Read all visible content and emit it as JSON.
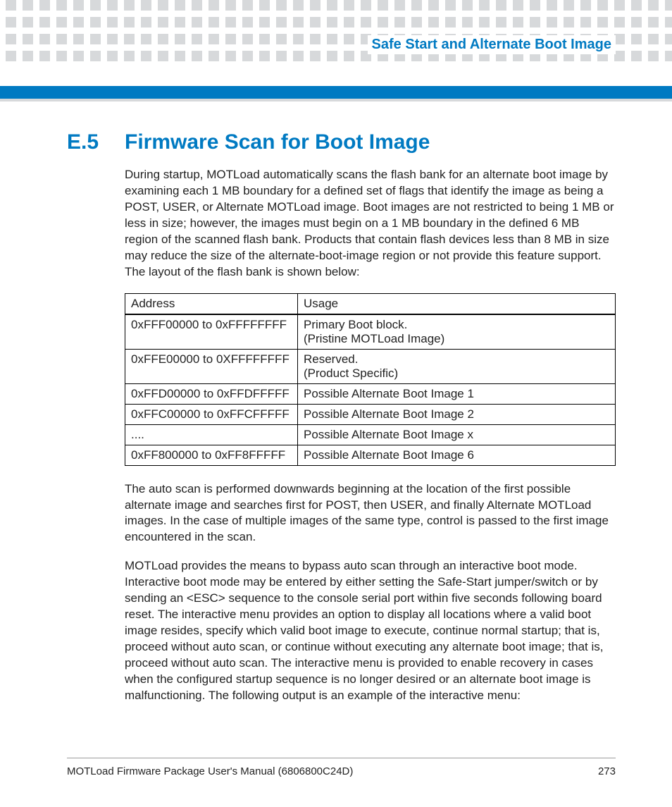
{
  "header": {
    "chapter_title": "Safe Start and Alternate Boot Image"
  },
  "section": {
    "number": "E.5",
    "title": "Firmware Scan for Boot Image"
  },
  "paragraphs": {
    "p1": "During startup, MOTLoad automatically scans the flash bank for an alternate boot image by examining each 1 MB  boundary for a defined set of flags that identify the image as being a POST, USER, or Alternate MOTLoad image. Boot images are not restricted to being 1 MB  or less in size; however, the images must begin on a 1 MB boundary in the defined 6 MB region of the scanned flash bank. Products that contain flash devices less than 8 MB in size may reduce the size of the alternate-boot-image region or not provide this feature support. The layout of the flash bank is shown below:",
    "p2": "The auto scan is performed downwards beginning at the location of the first possible alternate image and searches first for POST, then USER, and finally Alternate MOTLoad images. In the case of multiple images of the same type, control is passed to the first image encountered in the scan.",
    "p3": "MOTLoad provides the means to bypass auto scan through an interactive boot mode. Interactive boot mode may be entered by either setting the Safe-Start jumper/switch or by sending an <ESC> sequence to the console serial port within five seconds following board reset. The interactive menu provides an option to display all locations where a valid boot image resides, specify which valid boot image to execute, continue normal startup; that is, proceed without auto scan, or continue without executing any alternate boot image; that is, proceed without auto scan. The interactive menu is provided to enable recovery in cases when the configured startup sequence is no longer desired or an alternate boot image is malfunctioning. The following output is an example of the interactive menu:"
  },
  "table": {
    "headers": {
      "c0": "Address",
      "c1": "Usage"
    },
    "rows": [
      {
        "c0": "0xFFF00000 to 0xFFFFFFFF",
        "c1": "Primary Boot block.\n(Pristine MOTLoad Image)"
      },
      {
        "c0": "0xFFE00000 to 0XFFFFFFFF",
        "c1": "Reserved.\n(Product Specific)"
      },
      {
        "c0": "0xFFD00000 to 0xFFDFFFFF",
        "c1": "Possible Alternate Boot Image 1"
      },
      {
        "c0": "0xFFC00000 to 0xFFCFFFFF",
        "c1": "Possible Alternate Boot Image 2"
      },
      {
        "c0": "....",
        "c1": "Possible Alternate Boot Image x"
      },
      {
        "c0": "0xFF800000 to 0xFF8FFFFF",
        "c1": "Possible Alternate Boot Image 6"
      }
    ]
  },
  "footer": {
    "doc_title": "MOTLoad Firmware Package User's Manual (6806800C24D)",
    "page": "273"
  }
}
